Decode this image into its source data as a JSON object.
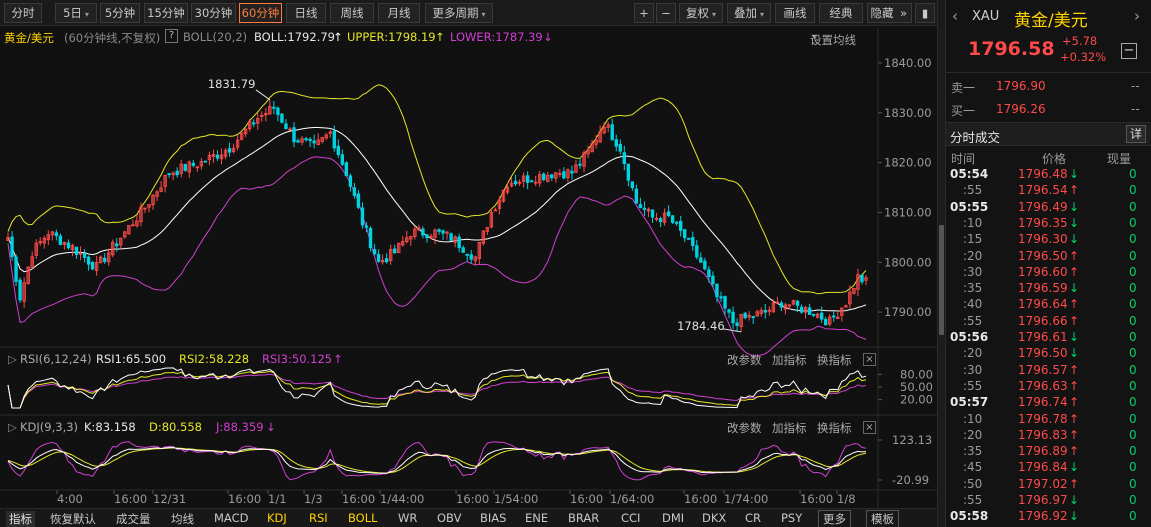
{
  "toolbar": {
    "periods": [
      {
        "label": "分时",
        "active": false,
        "dropdown": false
      },
      {
        "label": "5日",
        "active": false,
        "dropdown": true
      },
      {
        "label": "5分钟",
        "active": false,
        "dropdown": false
      },
      {
        "label": "15分钟",
        "active": false,
        "dropdown": false
      },
      {
        "label": "30分钟",
        "active": false,
        "dropdown": false
      },
      {
        "label": "60分钟",
        "active": true,
        "dropdown": false
      },
      {
        "label": "日线",
        "active": false,
        "dropdown": false
      },
      {
        "label": "周线",
        "active": false,
        "dropdown": false
      },
      {
        "label": "月线",
        "active": false,
        "dropdown": false
      },
      {
        "label": "更多周期",
        "active": false,
        "dropdown": true
      }
    ],
    "zoom_in": "+",
    "zoom_out": "−",
    "fuquan": "复权",
    "diejia": "叠加",
    "huaxian": "画线",
    "jingdian": "经典",
    "yincang": "隐藏",
    "collapse": "»"
  },
  "infobar": {
    "symbol": "黄金/美元",
    "mode": "(60分钟线,不复权)",
    "help": "?",
    "indicator": "BOLL(20,2)",
    "boll": "BOLL:1792.79",
    "upper": "UPPER:1798.19",
    "lower": "LOWER:1787.39",
    "settings": "设置均线"
  },
  "price_axis": [
    "1840.00",
    "1830.00",
    "1820.00",
    "1810.00",
    "1800.00",
    "1790.00"
  ],
  "annotations": {
    "high": "1831.79",
    "low": "1784.46"
  },
  "rsi_panel": {
    "name": "RSI(6,12,24)",
    "rsi1": "RSI1:65.500",
    "rsi2": "RSI2:58.228",
    "rsi3": "RSI3:50.125",
    "axis": [
      "80.00",
      "50.00",
      "20.00"
    ],
    "change_params": "改参数",
    "add_indicator": "加指标",
    "swap_indicator": "换指标"
  },
  "kdj_panel": {
    "name": "KDJ(9,3,3)",
    "k": "K:83.158",
    "d": "D:80.558",
    "j": "J:88.359",
    "axis": [
      "123.13",
      "-20.99"
    ],
    "change_params": "改参数",
    "add_indicator": "加指标",
    "swap_indicator": "换指标"
  },
  "time_axis": [
    "4:00",
    "16:00",
    "12/31",
    "16:00",
    "1/1",
    "1/3",
    "16:00",
    "1/44:00",
    "16:00",
    "1/54:00",
    "16:00",
    "1/64:00",
    "16:00",
    "1/74:00",
    "16:00",
    "1/8"
  ],
  "bottom_tabs": [
    "指标",
    "恢复默认",
    "成交量",
    "均线",
    "MACD",
    "KDJ",
    "RSI",
    "BOLL",
    "WR",
    "OBV",
    "BIAS",
    "ENE",
    "BRAR",
    "CCI",
    "DMI",
    "DKX",
    "CR",
    "PSY",
    "更多",
    "模板"
  ],
  "quote": {
    "code": "XAU",
    "name": "黄金/美元",
    "price": "1796.58",
    "change": "+5.78",
    "change_pct": "+0.32%",
    "sell_label": "卖一",
    "sell_price": "1796.90",
    "sell_vol": "--",
    "buy_label": "买一",
    "buy_price": "1796.26",
    "buy_vol": "--"
  },
  "trades": {
    "title": "分时成交",
    "detail": "详",
    "headers": [
      "时间",
      "价格",
      "现量"
    ],
    "rows": [
      {
        "time": "05:54",
        "price": "1796.48",
        "dir": "down",
        "vol": "0",
        "major": true
      },
      {
        "time": ":55",
        "price": "1796.54",
        "dir": "up",
        "vol": "0",
        "major": false
      },
      {
        "time": "05:55",
        "price": "1796.49",
        "dir": "down",
        "vol": "0",
        "major": true
      },
      {
        "time": ":10",
        "price": "1796.35",
        "dir": "down",
        "vol": "0",
        "major": false
      },
      {
        "time": ":15",
        "price": "1796.30",
        "dir": "down",
        "vol": "0",
        "major": false
      },
      {
        "time": ":20",
        "price": "1796.50",
        "dir": "up",
        "vol": "0",
        "major": false
      },
      {
        "time": ":30",
        "price": "1796.60",
        "dir": "up",
        "vol": "0",
        "major": false
      },
      {
        "time": ":35",
        "price": "1796.59",
        "dir": "down",
        "vol": "0",
        "major": false
      },
      {
        "time": ":40",
        "price": "1796.64",
        "dir": "up",
        "vol": "0",
        "major": false
      },
      {
        "time": ":55",
        "price": "1796.66",
        "dir": "up",
        "vol": "0",
        "major": false
      },
      {
        "time": "05:56",
        "price": "1796.61",
        "dir": "down",
        "vol": "0",
        "major": true
      },
      {
        "time": ":20",
        "price": "1796.50",
        "dir": "down",
        "vol": "0",
        "major": false
      },
      {
        "time": ":30",
        "price": "1796.57",
        "dir": "up",
        "vol": "0",
        "major": false
      },
      {
        "time": ":55",
        "price": "1796.63",
        "dir": "up",
        "vol": "0",
        "major": false
      },
      {
        "time": "05:57",
        "price": "1796.74",
        "dir": "up",
        "vol": "0",
        "major": true
      },
      {
        "time": ":10",
        "price": "1796.78",
        "dir": "up",
        "vol": "0",
        "major": false
      },
      {
        "time": ":20",
        "price": "1796.83",
        "dir": "up",
        "vol": "0",
        "major": false
      },
      {
        "time": ":35",
        "price": "1796.89",
        "dir": "up",
        "vol": "0",
        "major": false
      },
      {
        "time": ":45",
        "price": "1796.84",
        "dir": "down",
        "vol": "0",
        "major": false
      },
      {
        "time": ":50",
        "price": "1797.02",
        "dir": "up",
        "vol": "0",
        "major": false
      },
      {
        "time": ":55",
        "price": "1796.97",
        "dir": "down",
        "vol": "0",
        "major": false
      },
      {
        "time": "05:58",
        "price": "1796.92",
        "dir": "down",
        "vol": "0",
        "major": true
      }
    ]
  },
  "colors": {
    "up": "#ff4a4a",
    "down": "#00d2e0",
    "boll_mid": "#ffffff",
    "boll_upper": "#e6e628",
    "boll_lower": "#d040d0",
    "active": "#ff7a3c"
  },
  "chart_data": {
    "type": "candlestick",
    "interval": "60分钟",
    "y_range": [
      1784,
      1843
    ],
    "last": {
      "boll": 1792.79,
      "upper": 1798.19,
      "lower": 1787.39
    },
    "anchors": [
      [
        0,
        1805
      ],
      [
        3,
        1793
      ],
      [
        6,
        1802
      ],
      [
        10,
        1806
      ],
      [
        16,
        1803
      ],
      [
        22,
        1799
      ],
      [
        28,
        1805
      ],
      [
        34,
        1811
      ],
      [
        40,
        1818
      ],
      [
        48,
        1820
      ],
      [
        55,
        1823
      ],
      [
        62,
        1829
      ],
      [
        66,
        1831
      ],
      [
        71,
        1825
      ],
      [
        76,
        1823
      ],
      [
        80,
        1826
      ],
      [
        84,
        1818
      ],
      [
        88,
        1808
      ],
      [
        92,
        1800
      ],
      [
        96,
        1802
      ],
      [
        100,
        1806
      ],
      [
        106,
        1806
      ],
      [
        110,
        1805
      ],
      [
        116,
        1801
      ],
      [
        120,
        1810
      ],
      [
        124,
        1816
      ],
      [
        130,
        1817
      ],
      [
        136,
        1818
      ],
      [
        140,
        1818
      ],
      [
        144,
        1822
      ],
      [
        148,
        1828
      ],
      [
        152,
        1823
      ],
      [
        156,
        1812
      ],
      [
        160,
        1809
      ],
      [
        164,
        1809
      ],
      [
        168,
        1805
      ],
      [
        172,
        1800
      ],
      [
        176,
        1793
      ],
      [
        180,
        1788
      ],
      [
        184,
        1789
      ],
      [
        188,
        1790
      ],
      [
        192,
        1792
      ],
      [
        196,
        1791
      ],
      [
        200,
        1790
      ],
      [
        204,
        1788
      ],
      [
        208,
        1792
      ],
      [
        211,
        1797
      ],
      [
        213,
        1796
      ]
    ]
  }
}
